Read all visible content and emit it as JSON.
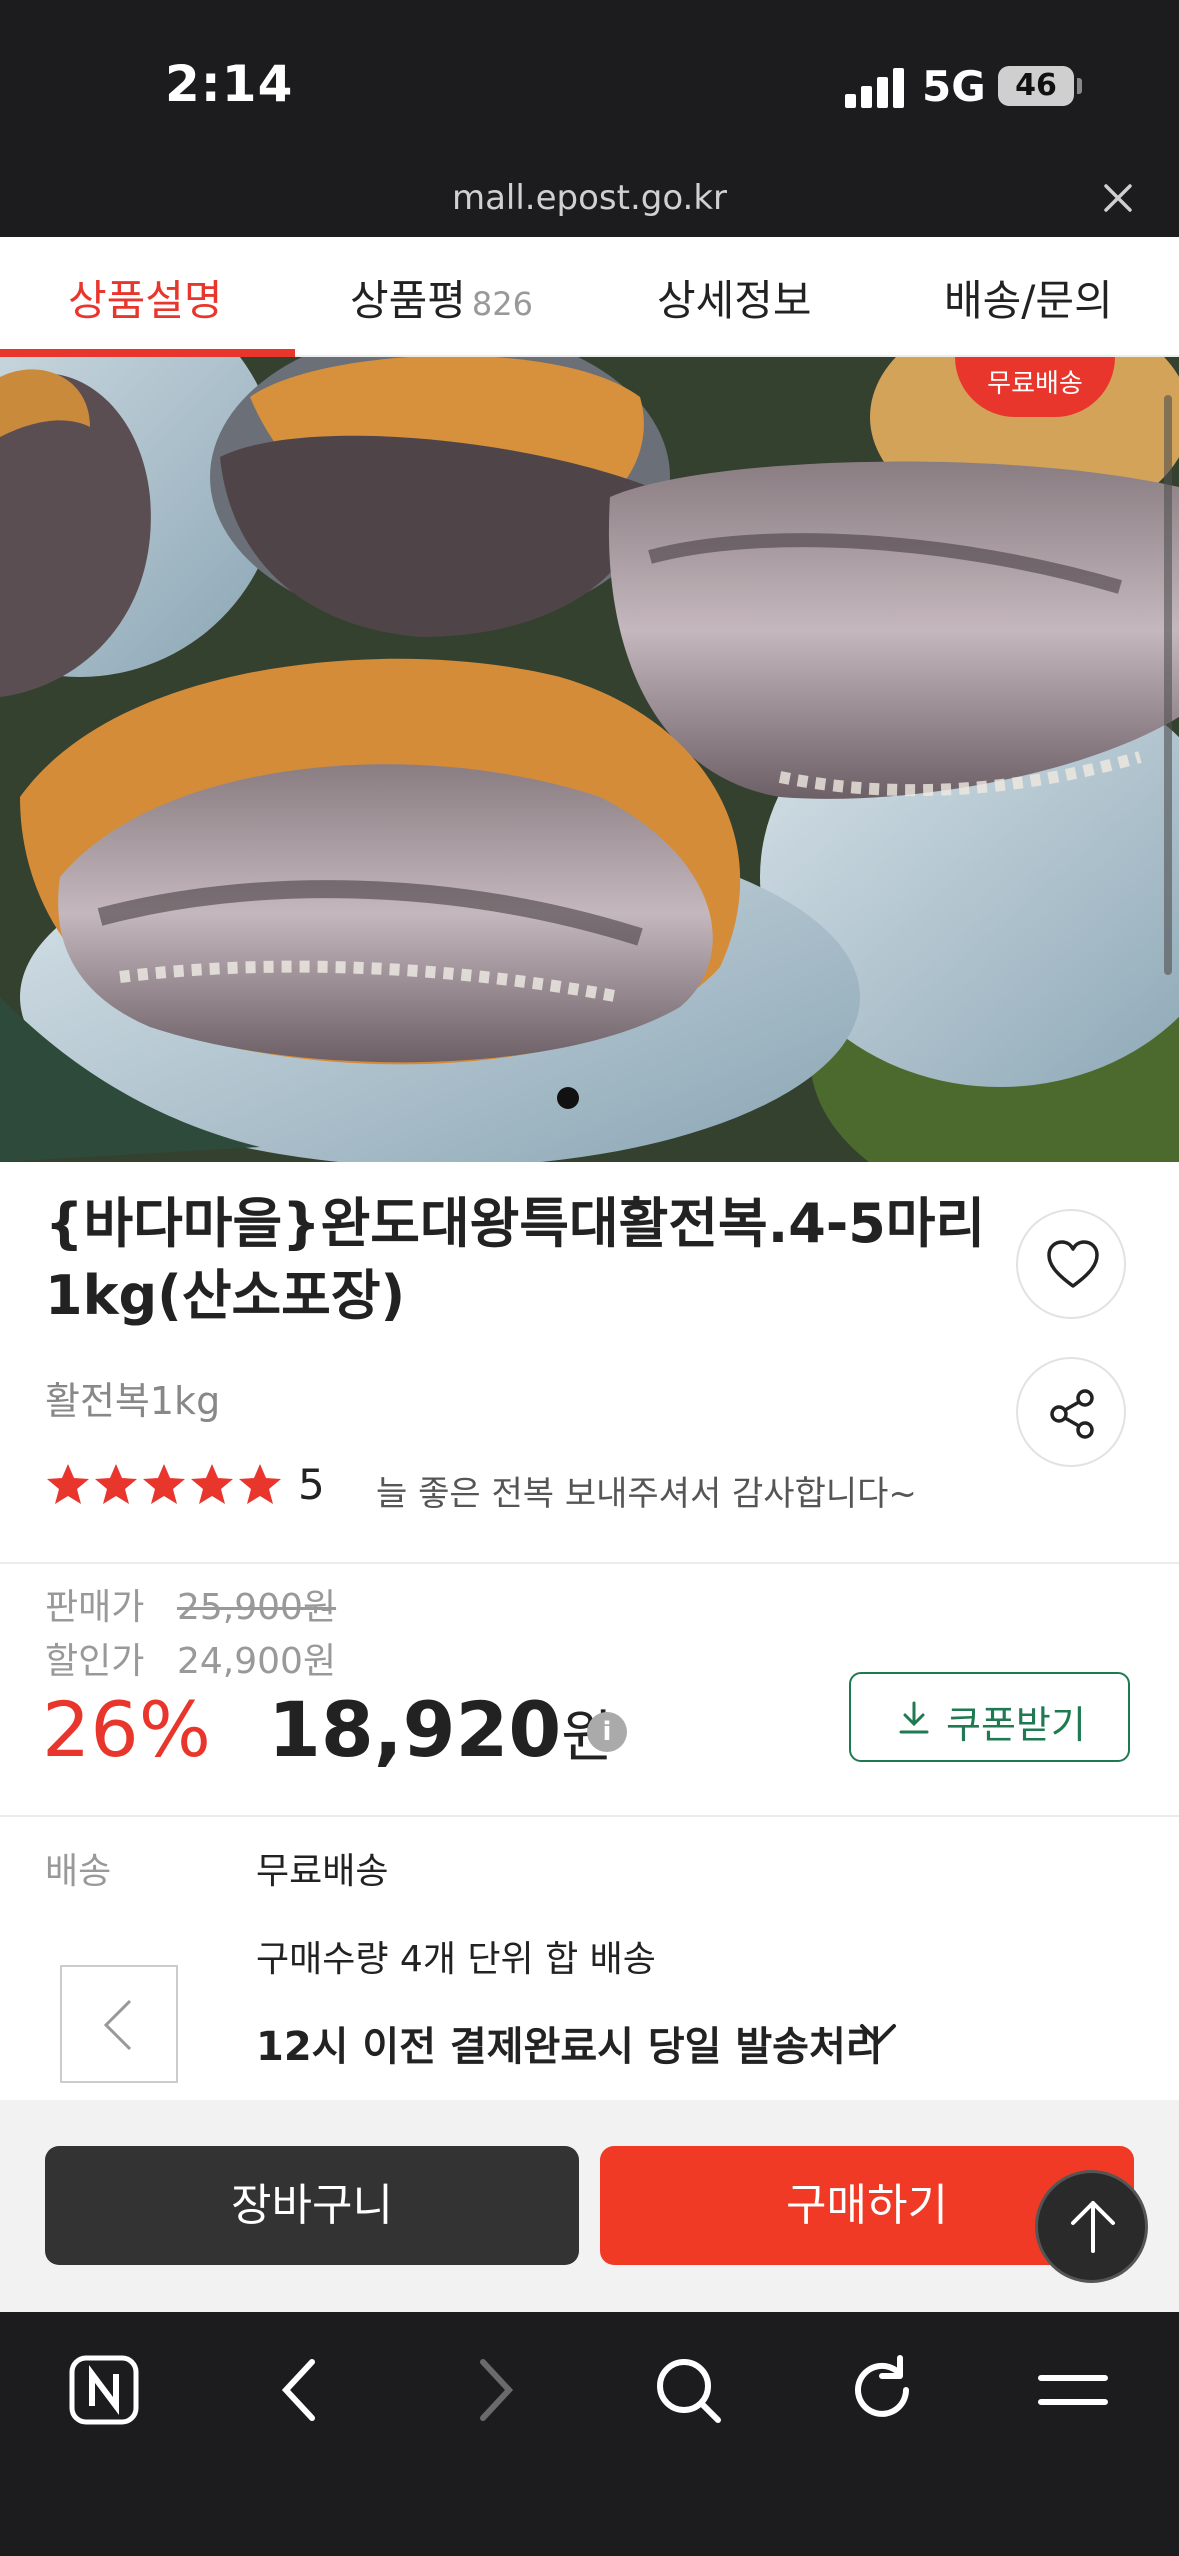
{
  "status_bar": {
    "time": "2:14",
    "network": "5G",
    "battery": "46"
  },
  "browser": {
    "url": "mall.epost.go.kr"
  },
  "tabs": [
    {
      "label": "상품설명"
    },
    {
      "label": "상품평",
      "count": "826"
    },
    {
      "label": "상세정보"
    },
    {
      "label": "배송/문의"
    }
  ],
  "hero": {
    "badge": "무료배송"
  },
  "product": {
    "title": "{바다마을}완도대왕특대활전복.4-5마리 1kg(산소포장)",
    "subtitle": "활전복1kg",
    "rating": "5",
    "review_snippet": "늘 좋은 전복 보내주셔서 감사합니다~"
  },
  "price": {
    "sale_label": "판매가",
    "sale_value": "25,900원",
    "discount_label": "할인가",
    "discount_value": "24,900원",
    "discount_rate": "26%",
    "final_price": "18,920",
    "final_unit": "원",
    "coupon_label": "쿠폰받기"
  },
  "shipping": {
    "label": "배송",
    "value": "무료배송",
    "note": "구매수량 4개 단위 합 배송",
    "dispatch": "12시 이전 결제완료시 당일 발송처리"
  },
  "actions": {
    "cart": "장바구니",
    "buy": "구매하기"
  },
  "colors": {
    "accent": "#e8362d",
    "buy": "#f03a26",
    "coupon": "#1f7a52"
  },
  "icons": [
    "heart-icon",
    "share-icon",
    "star-icon",
    "info-icon",
    "download-icon",
    "chevron-down-icon",
    "chevron-left-icon",
    "arrow-up-icon",
    "naver-icon",
    "back-icon",
    "forward-icon",
    "search-icon",
    "refresh-icon",
    "menu-icon",
    "close-icon"
  ]
}
